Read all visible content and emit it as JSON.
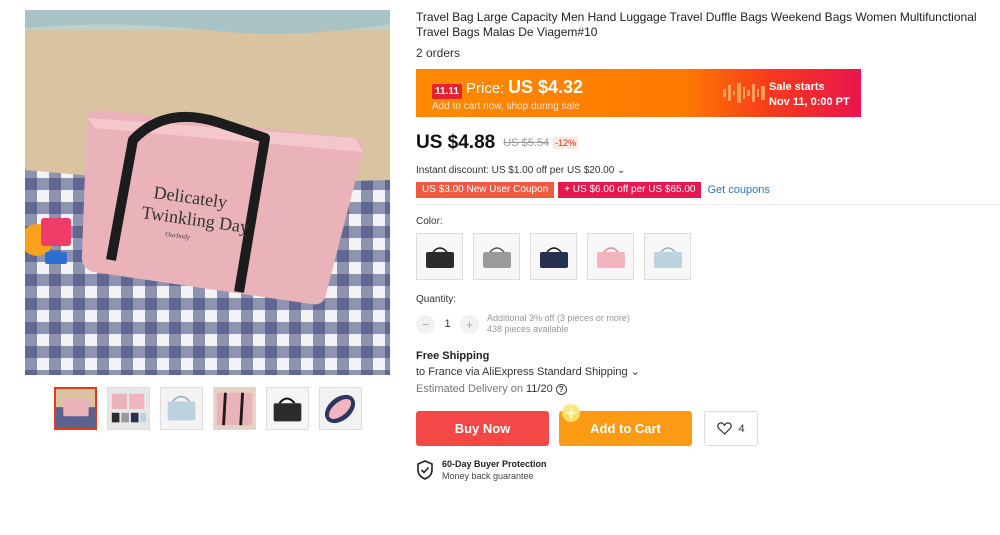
{
  "product": {
    "title": "Travel Bag Large Capacity Men Hand Luggage Travel Duffle Bags Weekend Bags Women Multifunctional Travel Bags Malas De Viagem#10",
    "orders": "2 orders",
    "bag_print_line1": "Delicately",
    "bag_print_line2": "Twinkling Day",
    "bag_print_signature": "Ourbody"
  },
  "gallery": {
    "thumbnails": [
      {
        "name": "pink bag on beach",
        "active": true
      },
      {
        "name": "colors overview",
        "active": false
      },
      {
        "name": "light blue bag",
        "active": false
      },
      {
        "name": "pink bag detail",
        "active": false
      },
      {
        "name": "black bag",
        "active": false
      },
      {
        "name": "bag zipper detail",
        "active": false
      }
    ]
  },
  "promo": {
    "badge": "11.11",
    "price_label": "Price:",
    "price_value": "US $4.32",
    "subtext": "Add to cart now, shop during sale",
    "sale_line1": "Sale starts",
    "sale_line2": "Nov 11, 0:00 PT"
  },
  "pricing": {
    "current": "US $4.88",
    "original": "US $5.54",
    "discount_pct": "-12%",
    "instant_discount": "Instant discount: US $1.00 off per US $20.00 ⌄"
  },
  "coupons": {
    "items": [
      "US $3.00 New User Coupon",
      "+ US $6.00 off per US $65.00"
    ],
    "get_link": "Get coupons"
  },
  "color": {
    "label": "Color:",
    "options": [
      {
        "name": "black",
        "hex": "#2b2b2b"
      },
      {
        "name": "gray",
        "hex": "#9a9a9a"
      },
      {
        "name": "navy",
        "hex": "#27304f"
      },
      {
        "name": "pink",
        "hex": "#f2b5bd"
      },
      {
        "name": "light blue",
        "hex": "#bcd3dd"
      }
    ]
  },
  "quantity": {
    "label": "Quantity:",
    "minus": "−",
    "value": "1",
    "plus": "+",
    "note_line1": "Additional 3% off (3 pieces or more)",
    "note_line2": "438 pieces available"
  },
  "shipping": {
    "title": "Free Shipping",
    "method": "to France via AliExpress Standard Shipping ⌄",
    "delivery_label": "Estimated Delivery on",
    "delivery_date": "11/20",
    "help_icon": "?"
  },
  "actions": {
    "buy_now": "Buy Now",
    "add_to_cart": "Add to Cart",
    "wishlist_count": "4"
  },
  "protection": {
    "title": "60-Day Buyer Protection",
    "subtitle": "Money back guarantee"
  },
  "colors": {
    "promo_start": "#ff8a00",
    "promo_end": "#e8154d",
    "buy_now": "#f44848",
    "add_to_cart": "#fd9b14",
    "coupon_1": "#f05a45",
    "coupon_2": "#e3194f",
    "link": "#2b7bc2"
  }
}
